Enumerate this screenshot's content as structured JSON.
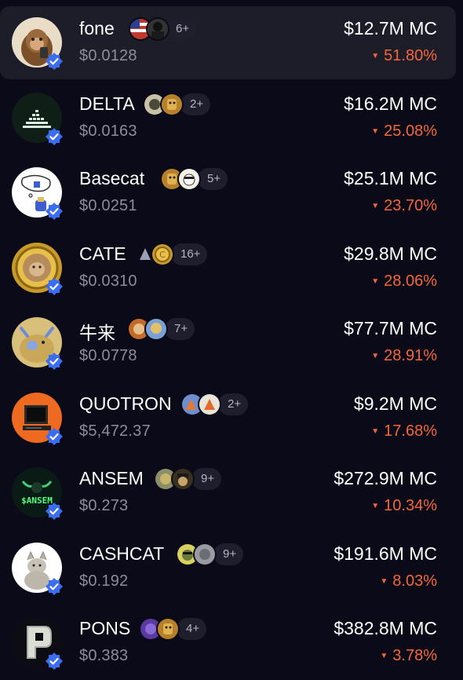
{
  "colors": {
    "background": "#0b0a18",
    "selected_row": "#1d1c29",
    "negative_change": "#f4673b",
    "verified_badge": "#3b6df0",
    "muted_text": "#8e8c9c"
  },
  "tokens": [
    {
      "name": "fone",
      "price": "$0.0128",
      "holders_count": "6+",
      "market_cap": "$12.7M MC",
      "change": "51.80%",
      "avatar_icon": "monkey-icon",
      "selected": true
    },
    {
      "name": "DELTA",
      "price": "$0.0163",
      "holders_count": "2+",
      "market_cap": "$16.2M MC",
      "change": "25.08%",
      "avatar_icon": "delta-pyramid-icon",
      "selected": false
    },
    {
      "name": "Basecat",
      "price": "$0.0251",
      "holders_count": "5+",
      "market_cap": "$25.1M MC",
      "change": "23.70%",
      "avatar_icon": "cat-thinking-icon",
      "selected": false
    },
    {
      "name": "CATE",
      "price": "$0.0310",
      "holders_count": "16+",
      "market_cap": "$29.8M MC",
      "change": "28.06%",
      "avatar_icon": "cat-coin-icon",
      "selected": false
    },
    {
      "name": "牛来",
      "price": "$0.0778",
      "holders_count": "7+",
      "market_cap": "$77.7M MC",
      "change": "28.91%",
      "avatar_icon": "bull-icon",
      "selected": false
    },
    {
      "name": "QUOTRON",
      "price": "$5,472.37",
      "holders_count": "2+",
      "market_cap": "$9.2M MC",
      "change": "17.68%",
      "avatar_icon": "computer-terminal-icon",
      "selected": false
    },
    {
      "name": "ANSEM",
      "price": "$0.273",
      "holders_count": "9+",
      "market_cap": "$272.9M MC",
      "change": "10.34%",
      "avatar_icon": "ansem-bull-icon",
      "selected": false
    },
    {
      "name": "CASHCAT",
      "price": "$0.192",
      "holders_count": "9+",
      "market_cap": "$191.6M MC",
      "change": "8.03%",
      "avatar_icon": "cat-photo-icon",
      "selected": false
    },
    {
      "name": "PONS",
      "price": "$0.383",
      "holders_count": "4+",
      "market_cap": "$382.8M MC",
      "change": "3.78%",
      "avatar_icon": "letter-p-icon",
      "selected": false
    }
  ]
}
